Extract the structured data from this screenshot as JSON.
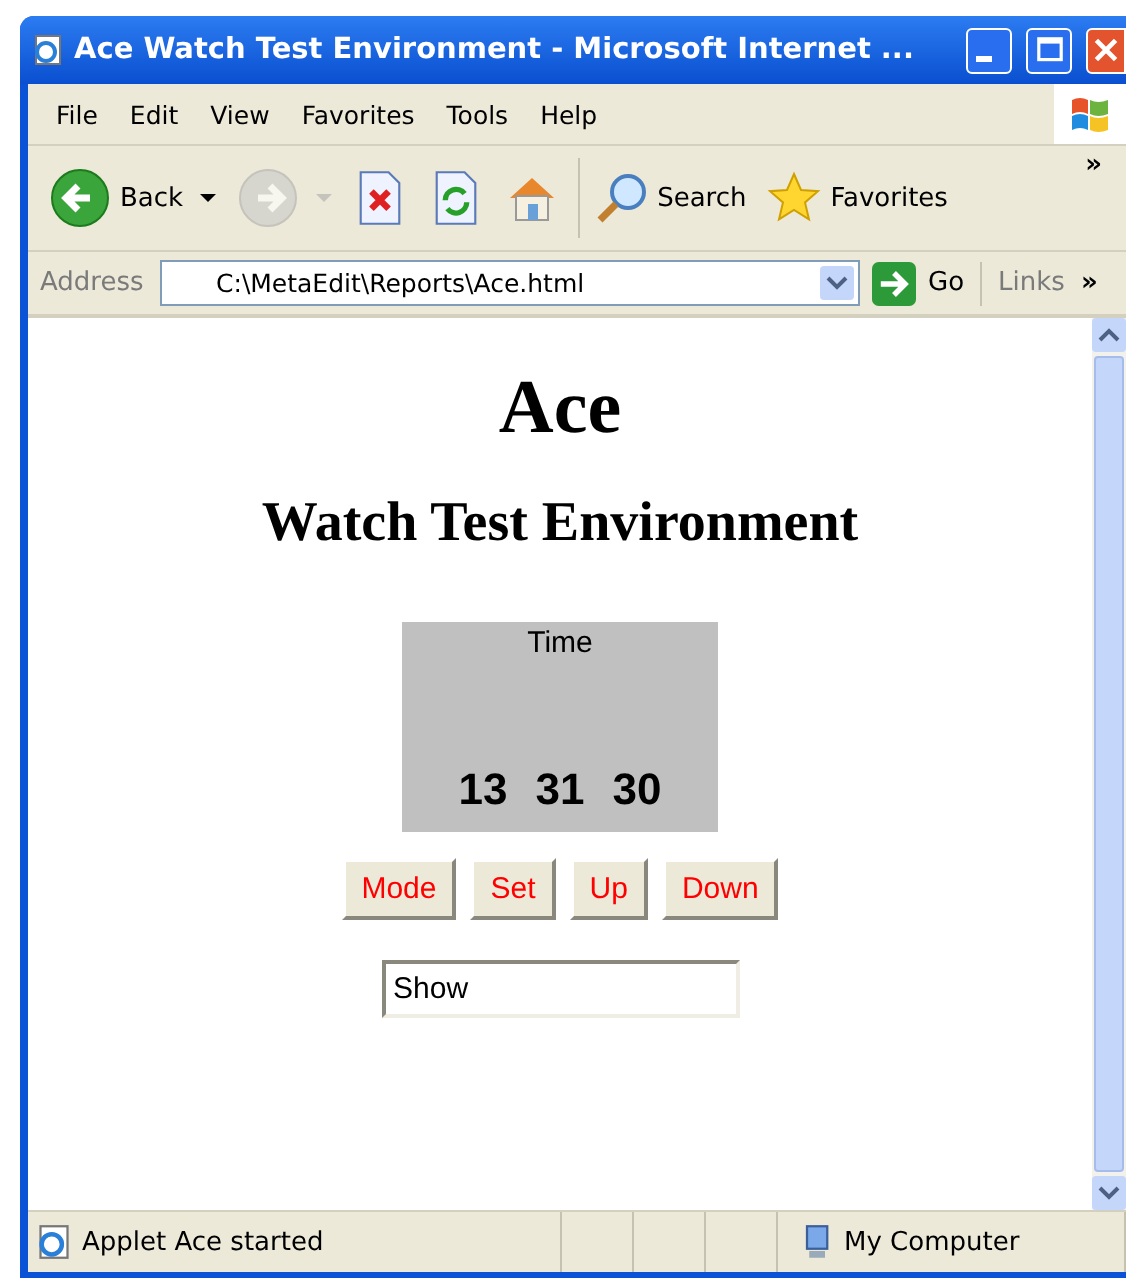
{
  "window": {
    "title": "Ace Watch Test Environment - Microsoft Internet ..."
  },
  "menu": [
    "File",
    "Edit",
    "View",
    "Favorites",
    "Tools",
    "Help"
  ],
  "toolbar": [
    {
      "kind": "back",
      "label": "Back",
      "disabled": false
    },
    {
      "kind": "forward",
      "disabled": true
    },
    {
      "kind": "stop",
      "disabled": false
    },
    {
      "kind": "refresh",
      "disabled": false
    },
    {
      "kind": "home",
      "disabled": false
    },
    {
      "kind": "search",
      "label": "Search",
      "disabled": false
    },
    {
      "kind": "favorites",
      "label": "Favorites",
      "disabled": false
    }
  ],
  "toolbar_more": "»",
  "address": {
    "label": "Address",
    "value": "C:\\MetaEdit\\Reports\\Ace.html",
    "go": "Go",
    "links": "Links",
    "links_more": "»"
  },
  "page": {
    "heading": "Ace",
    "subheading": "Watch Test Environment",
    "display": {
      "label": "Time",
      "hours": "13",
      "minutes": "31",
      "seconds": "30"
    },
    "buttons": [
      "Mode",
      "Set",
      "Up",
      "Down"
    ],
    "field": {
      "value": "Show"
    }
  },
  "status_bar": {
    "text": "Applet Ace started",
    "zone": "My Computer"
  }
}
